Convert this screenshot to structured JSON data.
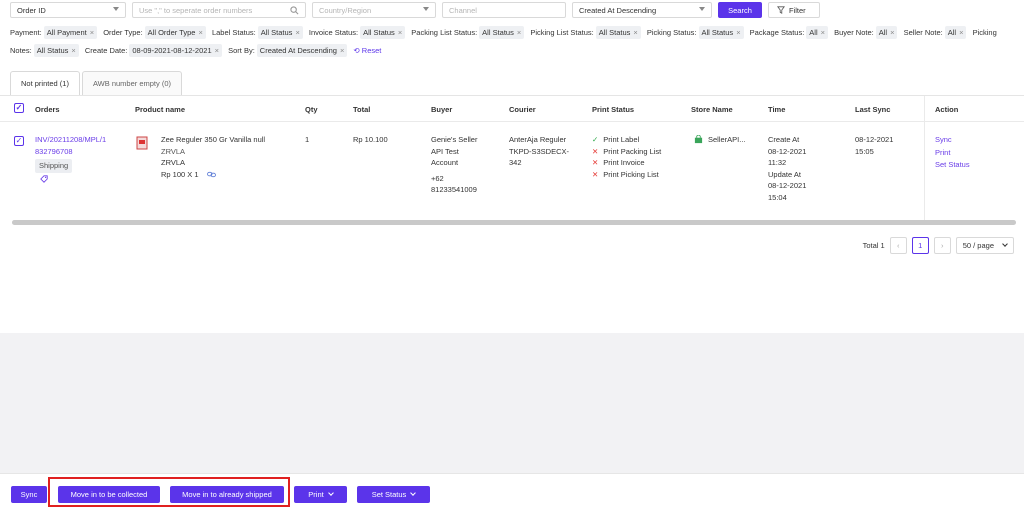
{
  "search": {
    "field_select": "Order ID",
    "order_input_placeholder": "Use \",\" to seperate order numbers",
    "country_placeholder": "Country/Region",
    "channel_placeholder": "Channel",
    "sort_select": "Created At Descending",
    "search_label": "Search",
    "filter_label": "Filter"
  },
  "filters": {
    "items": [
      {
        "label": "Payment:",
        "value": "All Payment"
      },
      {
        "label": "Order Type:",
        "value": "All Order Type"
      },
      {
        "label": "Label Status:",
        "value": "All Status"
      },
      {
        "label": "Invoice Status:",
        "value": "All Status"
      },
      {
        "label": "Packing List Status:",
        "value": "All Status"
      },
      {
        "label": "Picking List Status:",
        "value": "All Status"
      },
      {
        "label": "Picking Status:",
        "value": "All Status"
      },
      {
        "label": "Package Status:",
        "value": "All"
      },
      {
        "label": "Buyer Note:",
        "value": "All"
      },
      {
        "label": "Seller Note:",
        "value": "All"
      },
      {
        "label": "Picking Notes:",
        "value": "All Status"
      },
      {
        "label": "Create Date:",
        "value": "08-09-2021-08-12-2021"
      },
      {
        "label": "Sort By:",
        "value": "Created At Descending"
      }
    ],
    "reset_label": "Reset"
  },
  "tabs": [
    {
      "label": "Not printed (1)"
    },
    {
      "label": "AWB number empty (0)"
    }
  ],
  "table": {
    "headers": {
      "orders": "Orders",
      "product": "Product name",
      "qty": "Qty",
      "total": "Total",
      "buyer": "Buyer",
      "courier": "Courier",
      "print_status": "Print Status",
      "store": "Store Name",
      "time": "Time",
      "last_sync": "Last Sync",
      "action": "Action"
    },
    "row": {
      "order_no_1": "INV/20211208/MPL/1",
      "order_no_2": "832796708",
      "order_tag": "Shipping",
      "product_name": "Zee Reguler 350 Gr Vanilla null",
      "sku1": "ZRVLA",
      "sku2": "ZRVLA",
      "price": "Rp 100 X 1",
      "qty": "1",
      "total": "Rp 10.100",
      "buyer_1": "Genie's Seller",
      "buyer_2": "API Test",
      "buyer_3": "Account",
      "phone_1": "+62",
      "phone_2": "81233541009",
      "courier_1": "AnterAja Reguler",
      "courier_2": "TKPD-S3SDECX-",
      "courier_3": "342",
      "print_status": [
        {
          "label": "Print Label",
          "ok": true
        },
        {
          "label": "Print Packing List",
          "ok": false
        },
        {
          "label": "Print Invoice",
          "ok": false
        },
        {
          "label": "Print Picking List",
          "ok": false
        }
      ],
      "store": "SellerAPI...",
      "time_create_label": "Create At",
      "time_create_date": "08-12-2021",
      "time_create_clock": "11:32",
      "time_update_label": "Update At",
      "time_update_date": "08-12-2021",
      "time_update_clock": "15:04",
      "sync_date": "08-12-2021",
      "sync_clock": "15:05",
      "actions": [
        "Sync",
        "Print",
        "Set Status"
      ]
    }
  },
  "pagination": {
    "total": "Total 1",
    "page": "1",
    "page_size": "50 / page"
  },
  "bottom": {
    "sync": "Sync",
    "collect": "Move in to be collected",
    "shipped": "Move in to already shipped",
    "print": "Print",
    "set_status": "Set Status"
  },
  "colors": {
    "accent": "#5b34ea",
    "highlight": "#e02020",
    "ok": "#28a745",
    "fail": "#e53935"
  }
}
